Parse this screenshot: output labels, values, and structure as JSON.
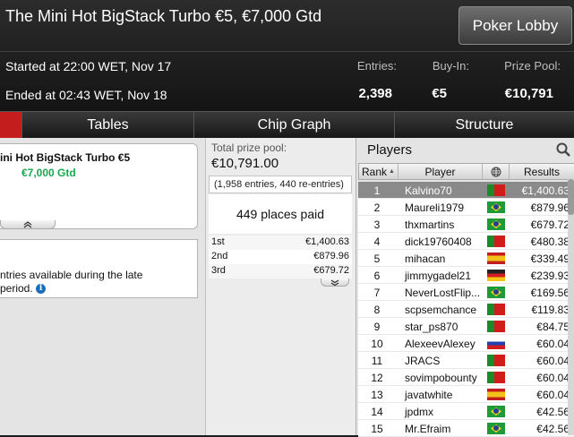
{
  "header": {
    "title": "The Mini Hot BigStack Turbo €5, €7,000 Gtd",
    "lobby_button": "Poker Lobby",
    "started": "Started at 22:00 WET, Nov 17",
    "ended": "Ended at 02:43 WET, Nov 18",
    "entries_label": "Entries:",
    "entries_value": "2,398",
    "buyin_label": "Buy-In:",
    "buyin_value": "€5",
    "prize_label": "Prize Pool:",
    "prize_value": "€10,791"
  },
  "tabs": {
    "tables": "Tables",
    "chip_graph": "Chip Graph",
    "structure": "Structure",
    "active_color": "#c41d1d"
  },
  "left_panel": {
    "card_name": "ini Hot BigStack Turbo €5",
    "card_gtd": "€7,000 Gtd",
    "note_line1": "ntries available during the late",
    "note_line2": "period."
  },
  "middle_panel": {
    "total_label": "Total prize pool:",
    "total_value": "€10,791.00",
    "entries_note": "(1,958 entries, 440 re-entries)",
    "places_paid": "449 places paid",
    "payouts": [
      {
        "place": "1st",
        "amount": "€1,400.63"
      },
      {
        "place": "2nd",
        "amount": "€879.96"
      },
      {
        "place": "3rd",
        "amount": "€679.72"
      }
    ]
  },
  "players": {
    "title": "Players",
    "columns": {
      "rank": "Rank",
      "player": "Player",
      "results": "Results"
    },
    "rows": [
      {
        "rank": "1",
        "name": "Kalvino70",
        "flag": "pt",
        "result": "€1,400.63"
      },
      {
        "rank": "2",
        "name": "Maureli1979",
        "flag": "br",
        "result": "€879.96"
      },
      {
        "rank": "3",
        "name": "thxmartins",
        "flag": "br",
        "result": "€679.72"
      },
      {
        "rank": "4",
        "name": "dick19760408",
        "flag": "pt",
        "result": "€480.38"
      },
      {
        "rank": "5",
        "name": "mihacan",
        "flag": "es",
        "result": "€339.49"
      },
      {
        "rank": "6",
        "name": "jimmygadel21",
        "flag": "de",
        "result": "€239.93"
      },
      {
        "rank": "7",
        "name": "NeverLostFlip...",
        "flag": "br",
        "result": "€169.56"
      },
      {
        "rank": "8",
        "name": "scpsemchance",
        "flag": "pt",
        "result": "€119.83"
      },
      {
        "rank": "9",
        "name": "star_ps870",
        "flag": "pt",
        "result": "€84.75"
      },
      {
        "rank": "10",
        "name": "AlexeevAlexey",
        "flag": "ru",
        "result": "€60.04"
      },
      {
        "rank": "11",
        "name": "JRACS",
        "flag": "pt",
        "result": "€60.04"
      },
      {
        "rank": "12",
        "name": "sovimpobounty",
        "flag": "pt",
        "result": "€60.04"
      },
      {
        "rank": "13",
        "name": "javatwhite",
        "flag": "es",
        "result": "€60.04"
      },
      {
        "rank": "14",
        "name": "jpdmx",
        "flag": "br",
        "result": "€42.56"
      },
      {
        "rank": "15",
        "name": "Mr.Efraim",
        "flag": "br",
        "result": "€42.56"
      }
    ]
  }
}
